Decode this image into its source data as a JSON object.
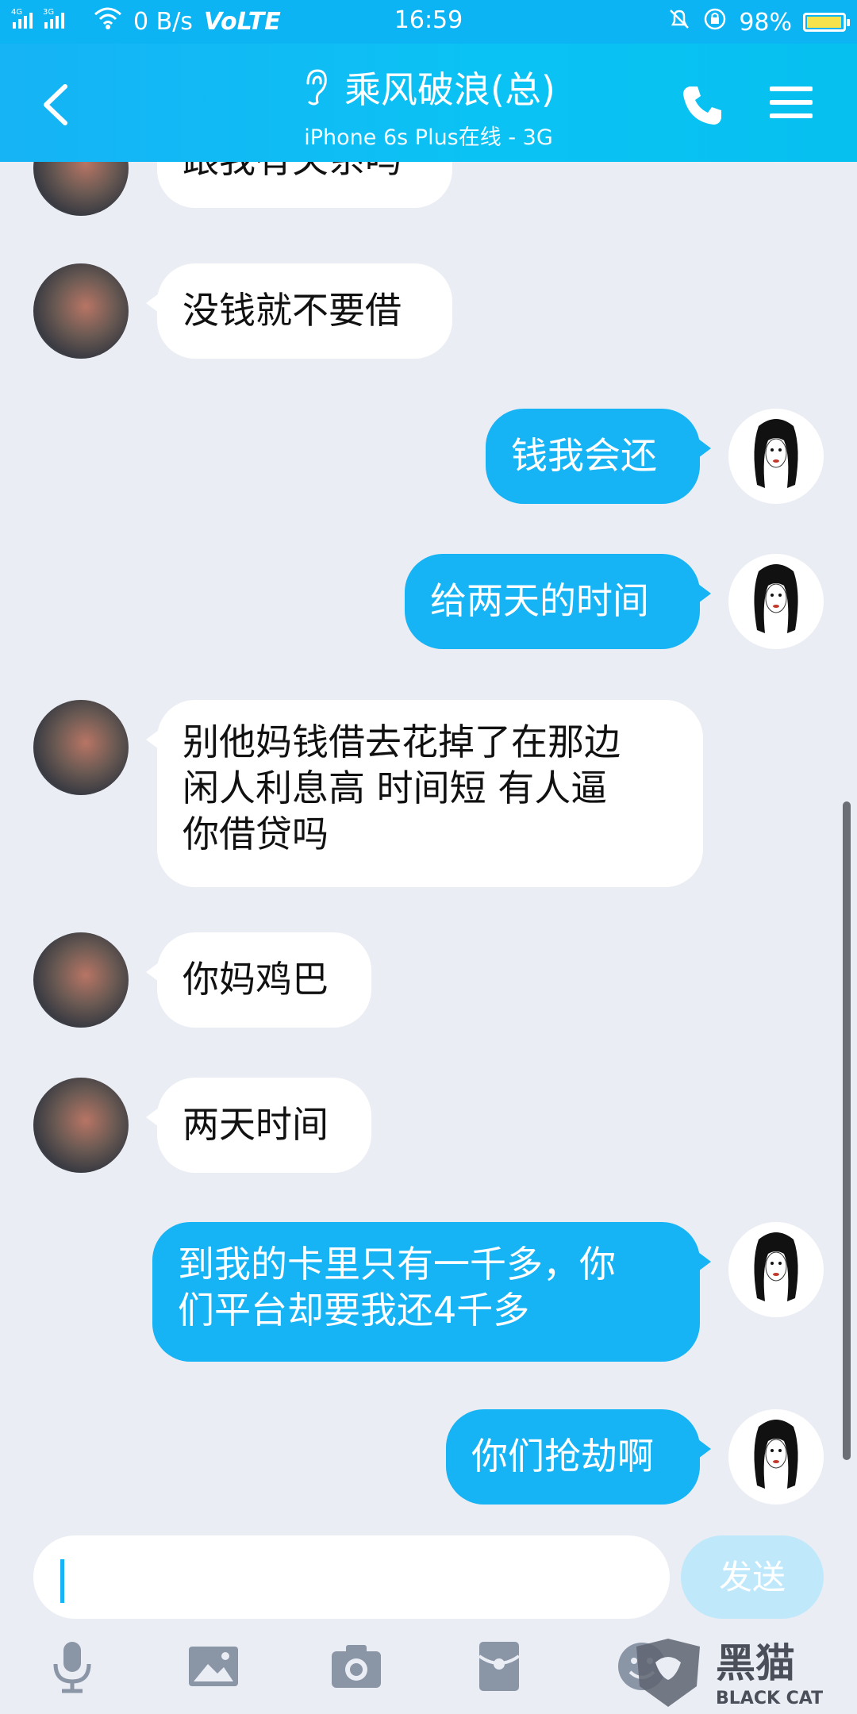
{
  "status": {
    "network": "4G 3G",
    "speed": "0 B/s",
    "volte": "VoLTE",
    "time": "16:59",
    "battery": "98%",
    "battery_level": 0.98
  },
  "header": {
    "title": "乘风破浪(总)",
    "subtitle": "iPhone 6s Plus在线 - 3G",
    "accent_color": "#16b3f5"
  },
  "messages": [
    {
      "side": "left",
      "text": "跟我有关系吗"
    },
    {
      "side": "left",
      "text": "没钱就不要借"
    },
    {
      "side": "right",
      "text": "钱我会还"
    },
    {
      "side": "right",
      "text": "给两天的时间"
    },
    {
      "side": "left",
      "text": "别他妈钱借去花掉了在那边\n闲人利息高 时间短   有人逼\n你借贷吗"
    },
    {
      "side": "left",
      "text": "你妈鸡巴"
    },
    {
      "side": "left",
      "text": "两天时间"
    },
    {
      "side": "right",
      "text": "到我的卡里只有一千多，你\n们平台却要我还4千多"
    },
    {
      "side": "right",
      "text": "你们抢劫啊"
    }
  ],
  "input": {
    "value": "",
    "send_label": "发送"
  },
  "toolbar": {
    "icons": [
      "microphone-icon",
      "image-icon",
      "camera-icon",
      "red-packet-icon",
      "emoji-icon"
    ]
  },
  "watermark": {
    "text": "黑猫",
    "subtext": "BLACK CAT"
  }
}
